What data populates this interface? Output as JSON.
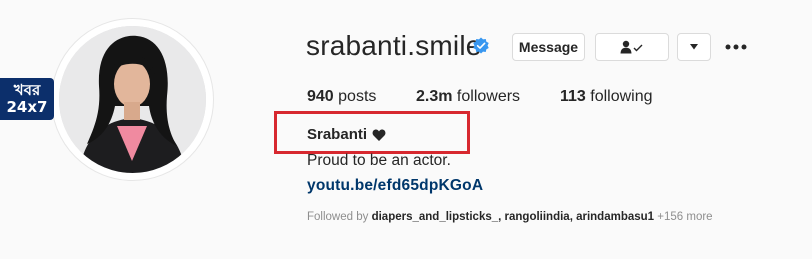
{
  "profile": {
    "username": "srabanti.smile",
    "verified_icon": "verified-badge-icon",
    "full_name": "Srabanti",
    "bio": "Proud to be an actor.",
    "link": "youtu.be/efd65dpKGoA"
  },
  "actions": {
    "message_label": "Message",
    "following_icon": "person-check-icon",
    "dropdown_icon": "caret-down-icon",
    "more_icon": "more-dots-icon"
  },
  "stats": {
    "posts_count": "940",
    "posts_label": "posts",
    "followers_count": "2.3m",
    "followers_label": "followers",
    "following_count": "113",
    "following_label": "following"
  },
  "followed_by": {
    "prefix": "Followed by",
    "names": "diapers_and_lipsticks_, rangoliindia, arindambasu1",
    "more": "+156 more"
  },
  "watermark": {
    "line1": "খবর",
    "line2": "24x7"
  },
  "colors": {
    "accent_blue": "#3897f0",
    "link_blue": "#00376b",
    "highlight_red": "#d7282f",
    "watermark_navy": "#0c2f6b"
  }
}
